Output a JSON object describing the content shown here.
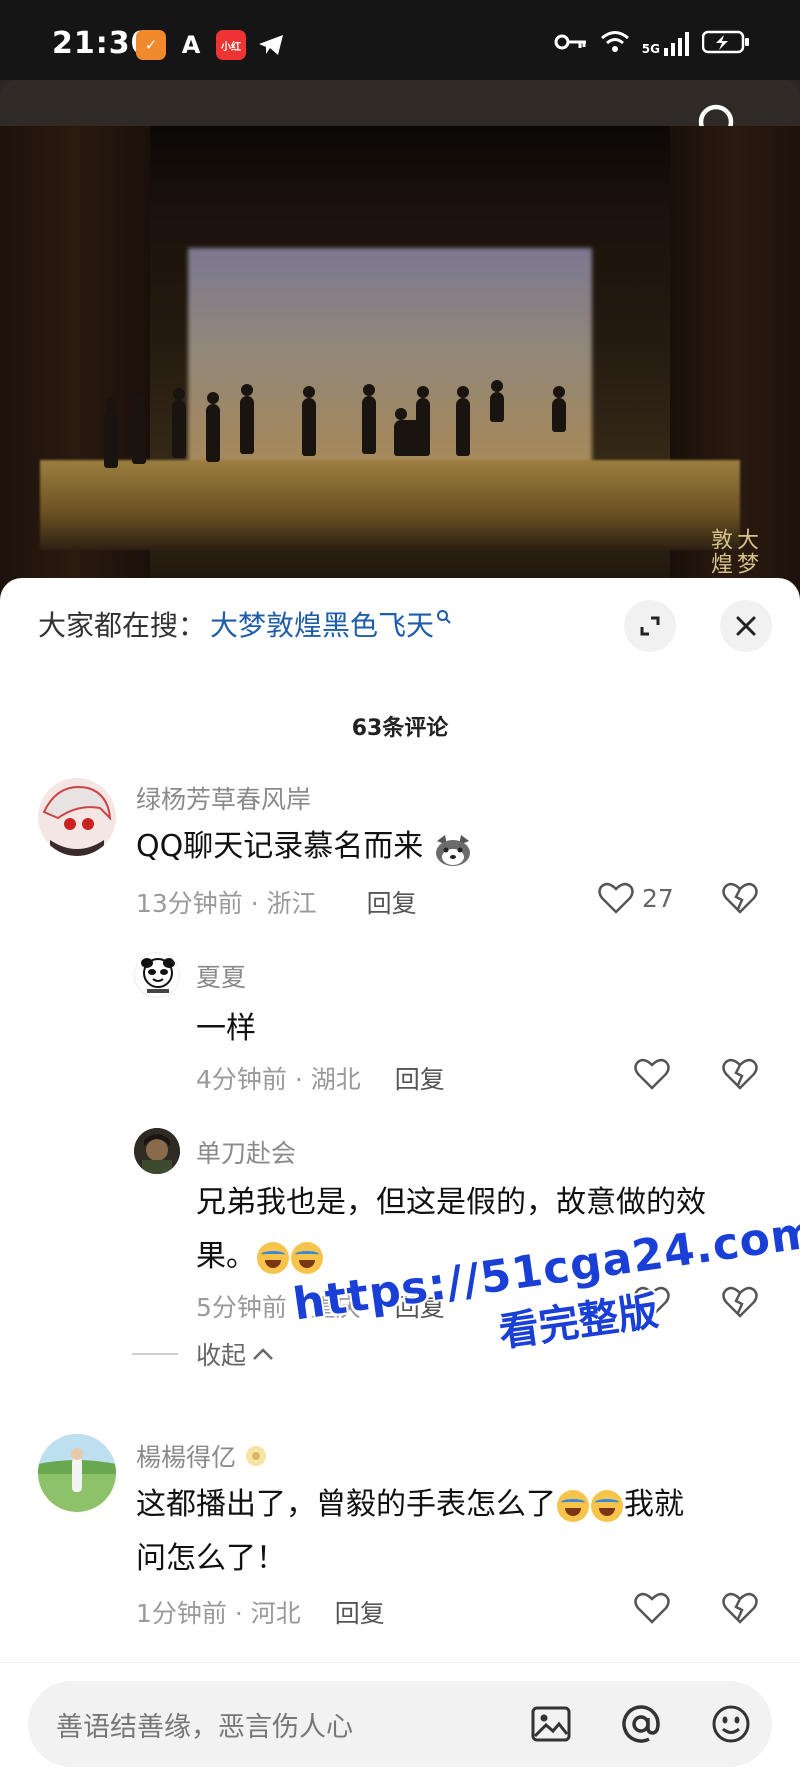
{
  "status_bar": {
    "time": "21:30",
    "network": "5G",
    "app_icons": [
      "shield-check-icon",
      "a-icon",
      "xhs-icon",
      "telegram-icon"
    ],
    "right_icons": [
      "key-icon",
      "wifi-icon",
      "signal-icon",
      "battery-charging-icon"
    ]
  },
  "video": {
    "watermark": "大梦敦煌"
  },
  "sheet": {
    "suggest_prefix": "大家都在搜：",
    "suggest_term": "大梦敦煌黑色飞天",
    "comment_count": "63条评论"
  },
  "comments": [
    {
      "name": "绿杨芳草春风岸",
      "text": "QQ聊天记录慕名而来",
      "time": "13分钟前 · 浙江",
      "reply": "回复",
      "likes": "27"
    },
    {
      "name": "夏夏",
      "text": "一样",
      "time": "4分钟前 · 湖北",
      "reply": "回复"
    },
    {
      "name": "单刀赴会",
      "text_line1": "兄弟我也是，但这是假的，故意做的效",
      "text_line2": "果。",
      "time": "5分钟前 · 重庆",
      "reply": "回复"
    },
    {
      "name": "楊楊得亿",
      "text_line1a": "这都播出了，曾毅的手表怎么了",
      "text_line1b": "我就",
      "text_line2": "问怎么了！",
      "time": "1分钟前 · 河北",
      "reply": "回复"
    }
  ],
  "collapse_label": "收起",
  "promo": {
    "url": "https://51cga24.com",
    "sub": "看完整版"
  },
  "input": {
    "placeholder": "善语结善缘，恶言伤人心"
  },
  "colors": {
    "link_blue": "#1f5dab",
    "promo_blue": "#1a3fd6"
  }
}
